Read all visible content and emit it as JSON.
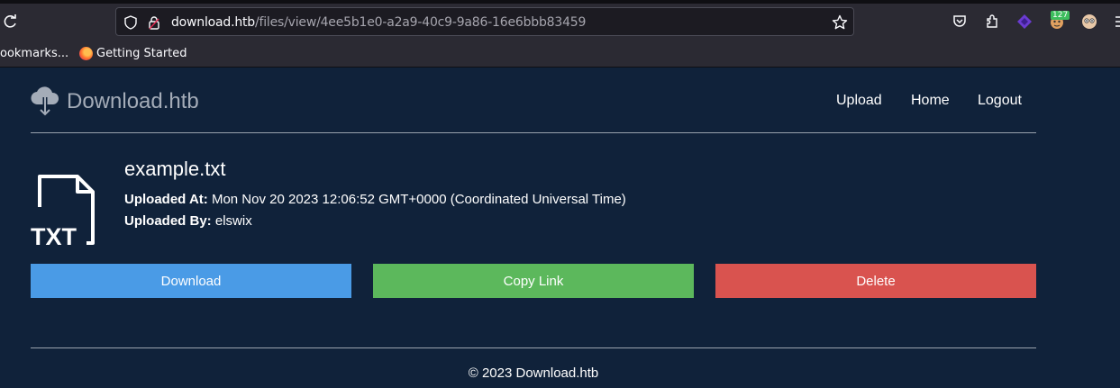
{
  "browser": {
    "url_domain": "download.htb",
    "url_path": "/files/view/4ee5b1e0-a2a9-40c9-9a86-16e6bbb83459",
    "toolbar_badge": "127",
    "bookmarks": [
      "ookmarks...",
      "Getting Started"
    ]
  },
  "site": {
    "brand": "Download.htb",
    "nav": [
      "Upload",
      "Home",
      "Logout"
    ]
  },
  "file": {
    "icon_label": "TXT",
    "name": "example.txt",
    "uploaded_at_label": "Uploaded At:",
    "uploaded_at_value": "Mon Nov 20 2023 12:06:52 GMT+0000 (Coordinated Universal Time)",
    "uploaded_by_label": "Uploaded By:",
    "uploaded_by_value": "elswix"
  },
  "actions": {
    "download": "Download",
    "copy_link": "Copy Link",
    "delete": "Delete"
  },
  "footer": "© 2023 Download.htb",
  "colors": {
    "page_bg": "#10223a",
    "download": "#4a9be6",
    "copy_link": "#5cb85c",
    "delete": "#d9534f"
  }
}
